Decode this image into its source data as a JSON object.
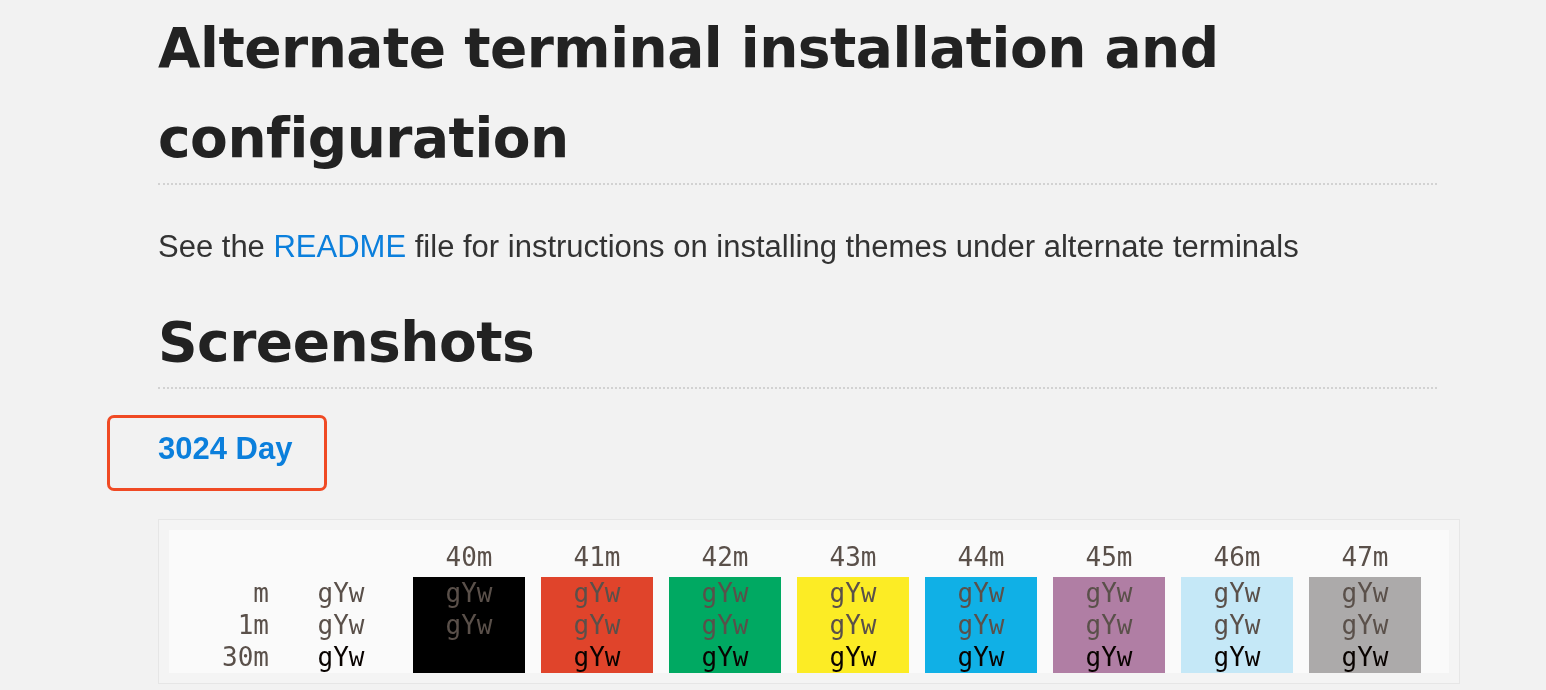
{
  "install_section": {
    "heading": "Alternate terminal installation and configuration",
    "paragraph": {
      "before": "See the ",
      "link": "README",
      "after": " file for instructions on installing themes under alternate terminals"
    }
  },
  "screenshots_section": {
    "heading": "Screenshots",
    "theme_link": {
      "label": "3024 Day",
      "highlighted": true
    },
    "terminal": {
      "columns": [
        {
          "label": "40m",
          "color": "#000000"
        },
        {
          "label": "41m",
          "color": "#e0442b"
        },
        {
          "label": "42m",
          "color": "#00a962"
        },
        {
          "label": "43m",
          "color": "#fcec25"
        },
        {
          "label": "44m",
          "color": "#10b0e6"
        },
        {
          "label": "45m",
          "color": "#b07ea4"
        },
        {
          "label": "46m",
          "color": "#c5e8f7"
        },
        {
          "label": "47m",
          "color": "#acaaaa"
        }
      ],
      "rows": [
        {
          "label": "m",
          "color": "#5a504a",
          "default_cell": "gYw",
          "cells": [
            "gYw",
            "gYw",
            "gYw",
            "gYw",
            "gYw",
            "gYw",
            "gYw",
            "gYw"
          ]
        },
        {
          "label": "1m",
          "color": "#5a504a",
          "default_cell": "gYw",
          "cells": [
            "gYw",
            "gYw",
            "gYw",
            "gYw",
            "gYw",
            "gYw",
            "gYw",
            "gYw"
          ]
        },
        {
          "label": "30m",
          "color": "#090300",
          "default_cell": "gYw",
          "cells": [
            null,
            "gYw",
            "gYw",
            "gYw",
            "gYw",
            "gYw",
            "gYw",
            "gYw"
          ]
        }
      ]
    }
  }
}
